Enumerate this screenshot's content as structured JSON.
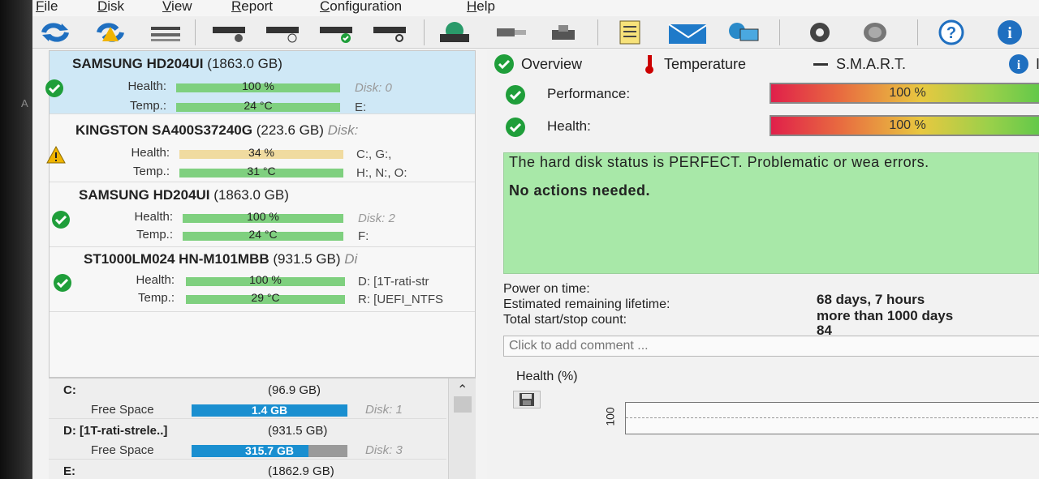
{
  "menu": [
    "File",
    "Disk",
    "View",
    "Report",
    "Configuration",
    "Help"
  ],
  "toolbar": {
    "icons": [
      "refresh-icon",
      "refresh-warning-icon",
      "disk-list-icon",
      "disk-icon",
      "disk-clock-icon",
      "disk-check-icon",
      "disk-search-icon",
      "disk-globe-icon",
      "usb-disk-icon",
      "network-disk-icon",
      "notes-icon",
      "email-icon",
      "network-computer-icon",
      "gear-icon",
      "speaker-icon",
      "help-icon",
      "info-icon"
    ]
  },
  "disks": [
    {
      "title": "SAMSUNG HD204UI",
      "size": "(1863.0 GB)",
      "extra": "",
      "health_label": "Health:",
      "health_value": "100 %",
      "health_fraction": 1.0,
      "temp_label": "Temp.:",
      "temp_value": "24 °C",
      "info1": "Disk: 0",
      "info2": "E:",
      "status": "ok"
    },
    {
      "title": "KINGSTON SA400S37240G",
      "size": "(223.6 GB)",
      "extra": "Disk:",
      "health_label": "Health:",
      "health_value": "34 %",
      "health_fraction": 0.34,
      "temp_label": "Temp.:",
      "temp_value": "31 °C",
      "info1": "C:, G:,",
      "info2": "H:, N:, O:",
      "status": "warning"
    },
    {
      "title": "SAMSUNG HD204UI",
      "size": "(1863.0 GB)",
      "extra": "",
      "health_label": "Health:",
      "health_value": "100 %",
      "health_fraction": 1.0,
      "temp_label": "Temp.:",
      "temp_value": "24 °C",
      "info1": "Disk: 2",
      "info2": "F:",
      "status": "ok"
    },
    {
      "title": "ST1000LM024 HN-M101MBB",
      "size": "(931.5 GB)",
      "extra": "Di",
      "health_label": "Health:",
      "health_value": "100 %",
      "health_fraction": 1.0,
      "temp_label": "Temp.:",
      "temp_value": "29 °C",
      "info1": "D: [1T-rati-str",
      "info2": "R: [UEFI_NTFS",
      "status": "ok"
    }
  ],
  "volumes": [
    {
      "name": "C:",
      "size": "(96.9 GB)",
      "free_label": "Free Space",
      "free_value": "1.4 GB",
      "free_fraction": 0.015,
      "disk": "Disk: 1"
    },
    {
      "name": "D: [1T-rati-strele..]",
      "size": "(931.5 GB)",
      "free_label": "Free Space",
      "free_value": "315.7 GB",
      "free_fraction": 0.339,
      "disk": "Disk: 3"
    },
    {
      "name": "E:",
      "size": "(1862.9 GB)"
    }
  ],
  "tabs": [
    "Overview",
    "Temperature",
    "S.M.A.R.T.",
    "In"
  ],
  "performance": {
    "label": "Performance:",
    "value": "100 %"
  },
  "health": {
    "label": "Health:",
    "value": "100 %"
  },
  "status_box": {
    "text": "The hard disk status is PERFECT. Problematic or wea errors.",
    "action": "No actions needed."
  },
  "info": [
    {
      "label": "Power on time:",
      "value": "68 days, 7 hours"
    },
    {
      "label": "Estimated remaining lifetime:",
      "value": "more than 1000 days"
    },
    {
      "label": "Total start/stop count:",
      "value": "84"
    }
  ],
  "comment_placeholder": "Click to add comment ...",
  "graph": {
    "title": "Health (%)",
    "y_label": "100"
  },
  "colors": {
    "ok": "#1f9e3a",
    "warning": "#e0a800",
    "selected": "#cfe8f6",
    "status_bg": "#a8e8a8",
    "volume_bar": "#1a8fd0"
  }
}
